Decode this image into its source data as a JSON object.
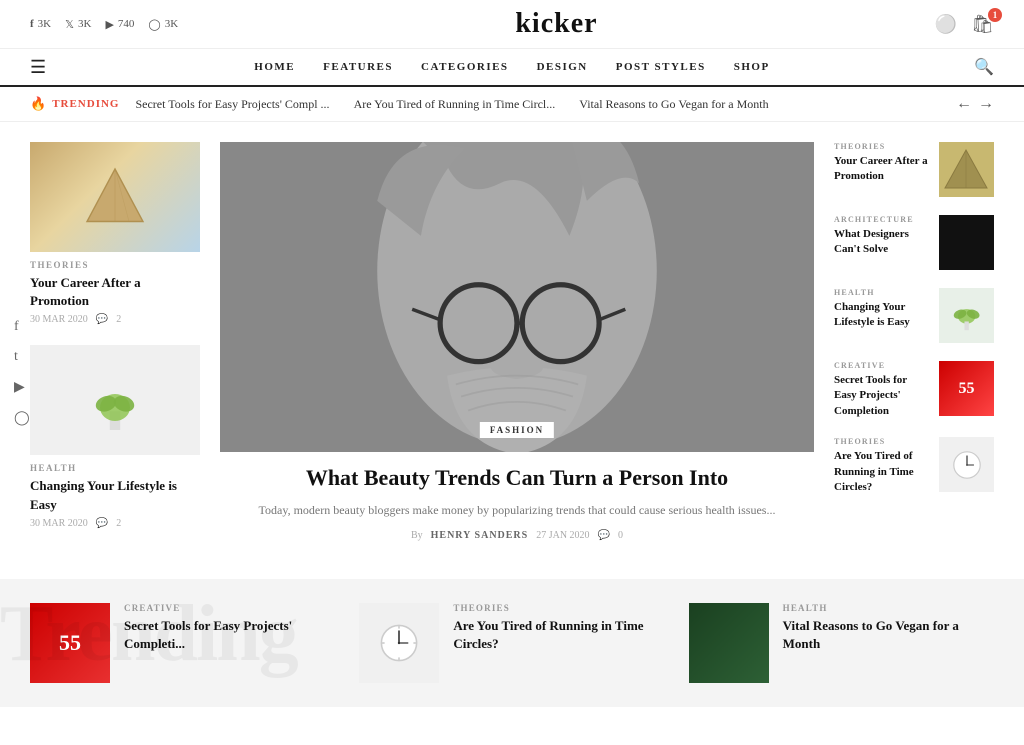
{
  "site": {
    "logo": "kicker"
  },
  "topBar": {
    "social": [
      {
        "icon": "f",
        "platform": "facebook",
        "count": "3K"
      },
      {
        "icon": "t",
        "platform": "twitter",
        "count": "3K"
      },
      {
        "icon": "▶",
        "platform": "youtube",
        "count": "740"
      },
      {
        "icon": "◎",
        "platform": "instagram",
        "count": "3K"
      }
    ]
  },
  "nav": {
    "items": [
      "HOME",
      "FEATURES",
      "CATEGORIES",
      "DESIGN",
      "POST STYLES",
      "SHOP"
    ]
  },
  "trending": {
    "label": "TRENDING",
    "items": [
      "Secret Tools for Easy Projects' Compl ...",
      "Are You Tired of Running in Time Circl...",
      "Vital Reasons to Go Vegan for a Month"
    ]
  },
  "leftArticles": [
    {
      "category": "THEORIES",
      "title": "Your Career After a Promotion",
      "date": "30 MAR 2020",
      "comments": "2",
      "imgType": "triangle"
    },
    {
      "category": "HEALTH",
      "title": "Changing Your Lifestyle is Easy",
      "date": "30 MAR 2020",
      "comments": "2",
      "imgType": "plant"
    }
  ],
  "centerArticle": {
    "badge": "FASHION",
    "title": "What Beauty Trends Can Turn a Person Into",
    "excerpt": "Today, modern beauty bloggers make money by popularizing trends that could cause serious health issues...",
    "author": "HENRY SANDERS",
    "date": "27 JAN 2020",
    "comments": "0"
  },
  "rightArticles": [
    {
      "category": "THEORIES",
      "title": "Your Career After a Promotion",
      "imgType": "triangle"
    },
    {
      "category": "ARCHITECTURE",
      "title": "What Designers Can't Solve",
      "imgType": "dark"
    },
    {
      "category": "HEALTH",
      "title": "Changing Your Lifestyle is Easy",
      "imgType": "plant"
    },
    {
      "category": "CREATIVE",
      "title": "Secret Tools for Easy Projects' Completion",
      "imgType": "red"
    },
    {
      "category": "THEORIES",
      "title": "Are You Tired of Running in Time Circles?",
      "imgType": "clock"
    }
  ],
  "sidebarSocial": [
    "f",
    "t",
    "▶",
    "◎"
  ],
  "bottomArticles": [
    {
      "category": "CREATIVE",
      "title": "Secret Tools for Easy Projects' Completi...",
      "imgType": "red"
    },
    {
      "category": "THEORIES",
      "title": "Are You Tired of Running in Time Circles?",
      "imgType": "clock"
    },
    {
      "category": "HEALTH",
      "title": "Vital Reasons to Go Vegan for a Month",
      "imgType": "green"
    }
  ]
}
